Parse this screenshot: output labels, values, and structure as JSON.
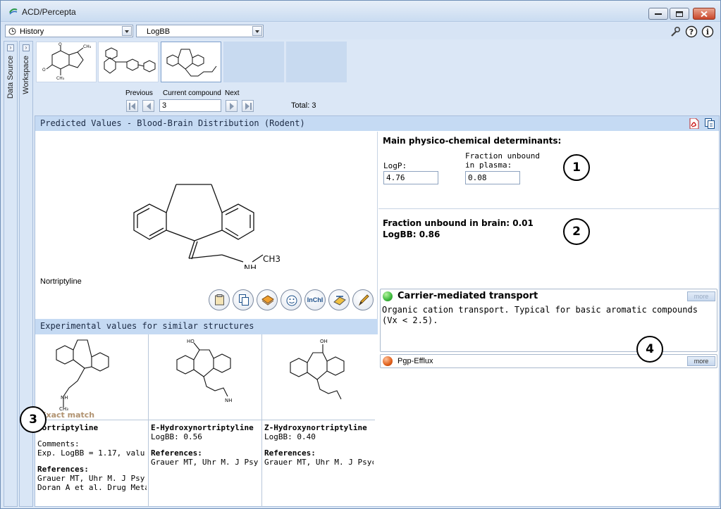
{
  "window": {
    "title": "ACD/Percepta"
  },
  "toolbar": {
    "history_label": "History",
    "module_label": "LogBB"
  },
  "side_tabs": {
    "data_source": "Data Source",
    "workspace": "Workspace"
  },
  "navigation": {
    "previous_label": "Previous",
    "current_label": "Current compound",
    "next_label": "Next",
    "current_value": "3",
    "total_text": "Total: 3"
  },
  "predicted": {
    "header": "Predicted Values - Blood-Brain Distribution (Rodent)",
    "compound_name": "Nortriptyline",
    "ch3_label": "CH3",
    "nh_label": "NH",
    "inchi_label": "InChI"
  },
  "determinants": {
    "title": "Main physico-chemical determinants:",
    "logp_label": "LogP:",
    "logp_value": "4.76",
    "fu_label_1": "Fraction unbound",
    "fu_label_2": "in plasma:",
    "fu_value": "0.08"
  },
  "brain": {
    "fu_brain": "Fraction unbound in brain: 0.01",
    "logbb": "LogBB: 0.86"
  },
  "transport": {
    "carrier_title": "Carrier-mediated transport",
    "carrier_text": "Organic cation transport. Typical for basic aromatic compounds (Vx < 2.5).",
    "pgp_title": "Pgp-Efflux",
    "more_label": "more"
  },
  "experimental": {
    "header": "Experimental values for similar structures",
    "exact_match": "Exact match",
    "items": [
      {
        "name": "Nortriptyline",
        "comments_label": "Comments:",
        "comment": "Exp. LogBB = 1.17, valu..",
        "refs_label": "References:",
        "ref1": "Grauer MT, Uhr M. J Psy..",
        "ref2": "Doran A et al. Drug Meta.."
      },
      {
        "name": "E-Hydroxynortriptyline",
        "logbb": "LogBB: 0.56",
        "refs_label": "References:",
        "ref1": "Grauer MT, Uhr M. J Psy.."
      },
      {
        "name": "Z-Hydroxynortriptyline",
        "logbb": "LogBB: 0.40",
        "refs_label": "References:",
        "ref1": "Grauer MT, Uhr M. J Psyc.."
      }
    ]
  },
  "callouts": [
    "1",
    "2",
    "3",
    "4"
  ],
  "colors": {
    "accent_header": "#c5daf3",
    "status_green": "#3cb83c",
    "status_orange": "#e0601c"
  }
}
